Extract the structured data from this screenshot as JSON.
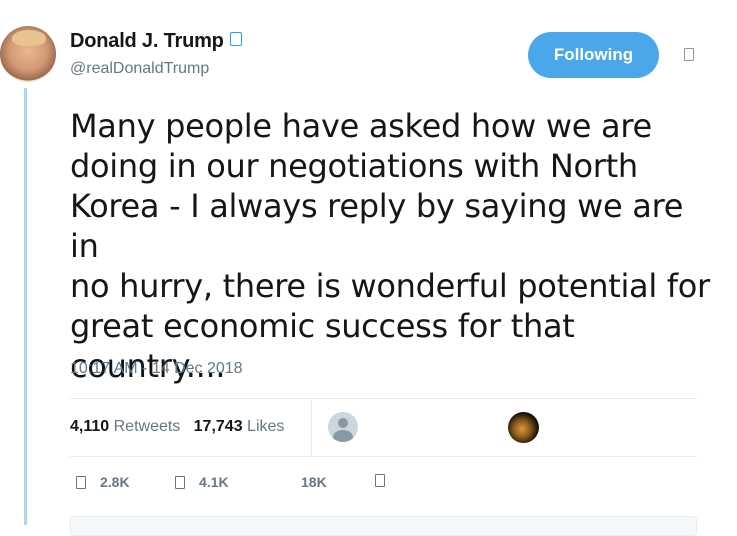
{
  "author": {
    "display_name": "Donald J. Trump",
    "handle": "@realDonaldTrump",
    "verified": true
  },
  "follow_button": {
    "label": "Following"
  },
  "tweet": {
    "lines": [
      "Many people have asked how we are",
      "doing in our negotiations with North",
      "Korea - I always reply by saying we are in",
      "no hurry, there is wonderful potential for",
      "great economic success for that",
      "country...."
    ],
    "timestamp": "10:17 AM - 14 Dec 2018"
  },
  "stats": {
    "retweets_count": "4,110",
    "retweets_label": "Retweets",
    "likes_count": "17,743",
    "likes_label": "Likes"
  },
  "actions": {
    "reply_count": "2.8K",
    "retweet_count": "4.1K",
    "like_count": "18K"
  },
  "colors": {
    "accent": "#1da1f2",
    "follow_button": "#4aa8ea",
    "muted_text": "#657786",
    "thread_line": "#a9d8f0"
  }
}
